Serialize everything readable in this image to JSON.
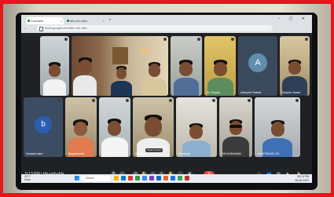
{
  "browser": {
    "tabs": [
      {
        "label": "Contacts"
      },
      {
        "label": "bfs-rvrb-dda"
      }
    ],
    "new_tab": "+",
    "url": "meet.google.com/bfs-rvrb-dda"
  },
  "meeting": {
    "time": "5:13 PM",
    "code": "bfs-rvrb-dda",
    "participants_row1": [
      {
        "name": ""
      },
      {
        "name": ""
      },
      {
        "name": ""
      },
      {
        "name": "Sri Tirupati"
      },
      {
        "name": "Sanjeev Sawai"
      },
      {
        "name": "Adesyhe Padwal",
        "initial": "A",
        "color": "#5f8fae"
      }
    ],
    "participants_row2": [
      {
        "name": "bhadrad saint",
        "initial": "b",
        "color": "#2a5fb0"
      },
      {
        "name": "Vijayalakshmi"
      },
      {
        "name": "Ravi"
      },
      {
        "name": "Kartheek"
      },
      {
        "name": "Ramaraju"
      },
      {
        "name": "PACHARAMAM"
      },
      {
        "name": "HARIPRASAD DE"
      }
    ],
    "presenter_label": "Share screen",
    "controls": {
      "end_call": "✆"
    }
  },
  "taskbar": {
    "weather_temp": "29°C",
    "weather_text": "Haze",
    "search_placeholder": "Search",
    "clock_time": "05:13 PM",
    "clock_date": "25-05-2023"
  },
  "colors": {
    "frame": "#e3171c",
    "meet_bg": "#202124",
    "end_call": "#ea4335"
  }
}
